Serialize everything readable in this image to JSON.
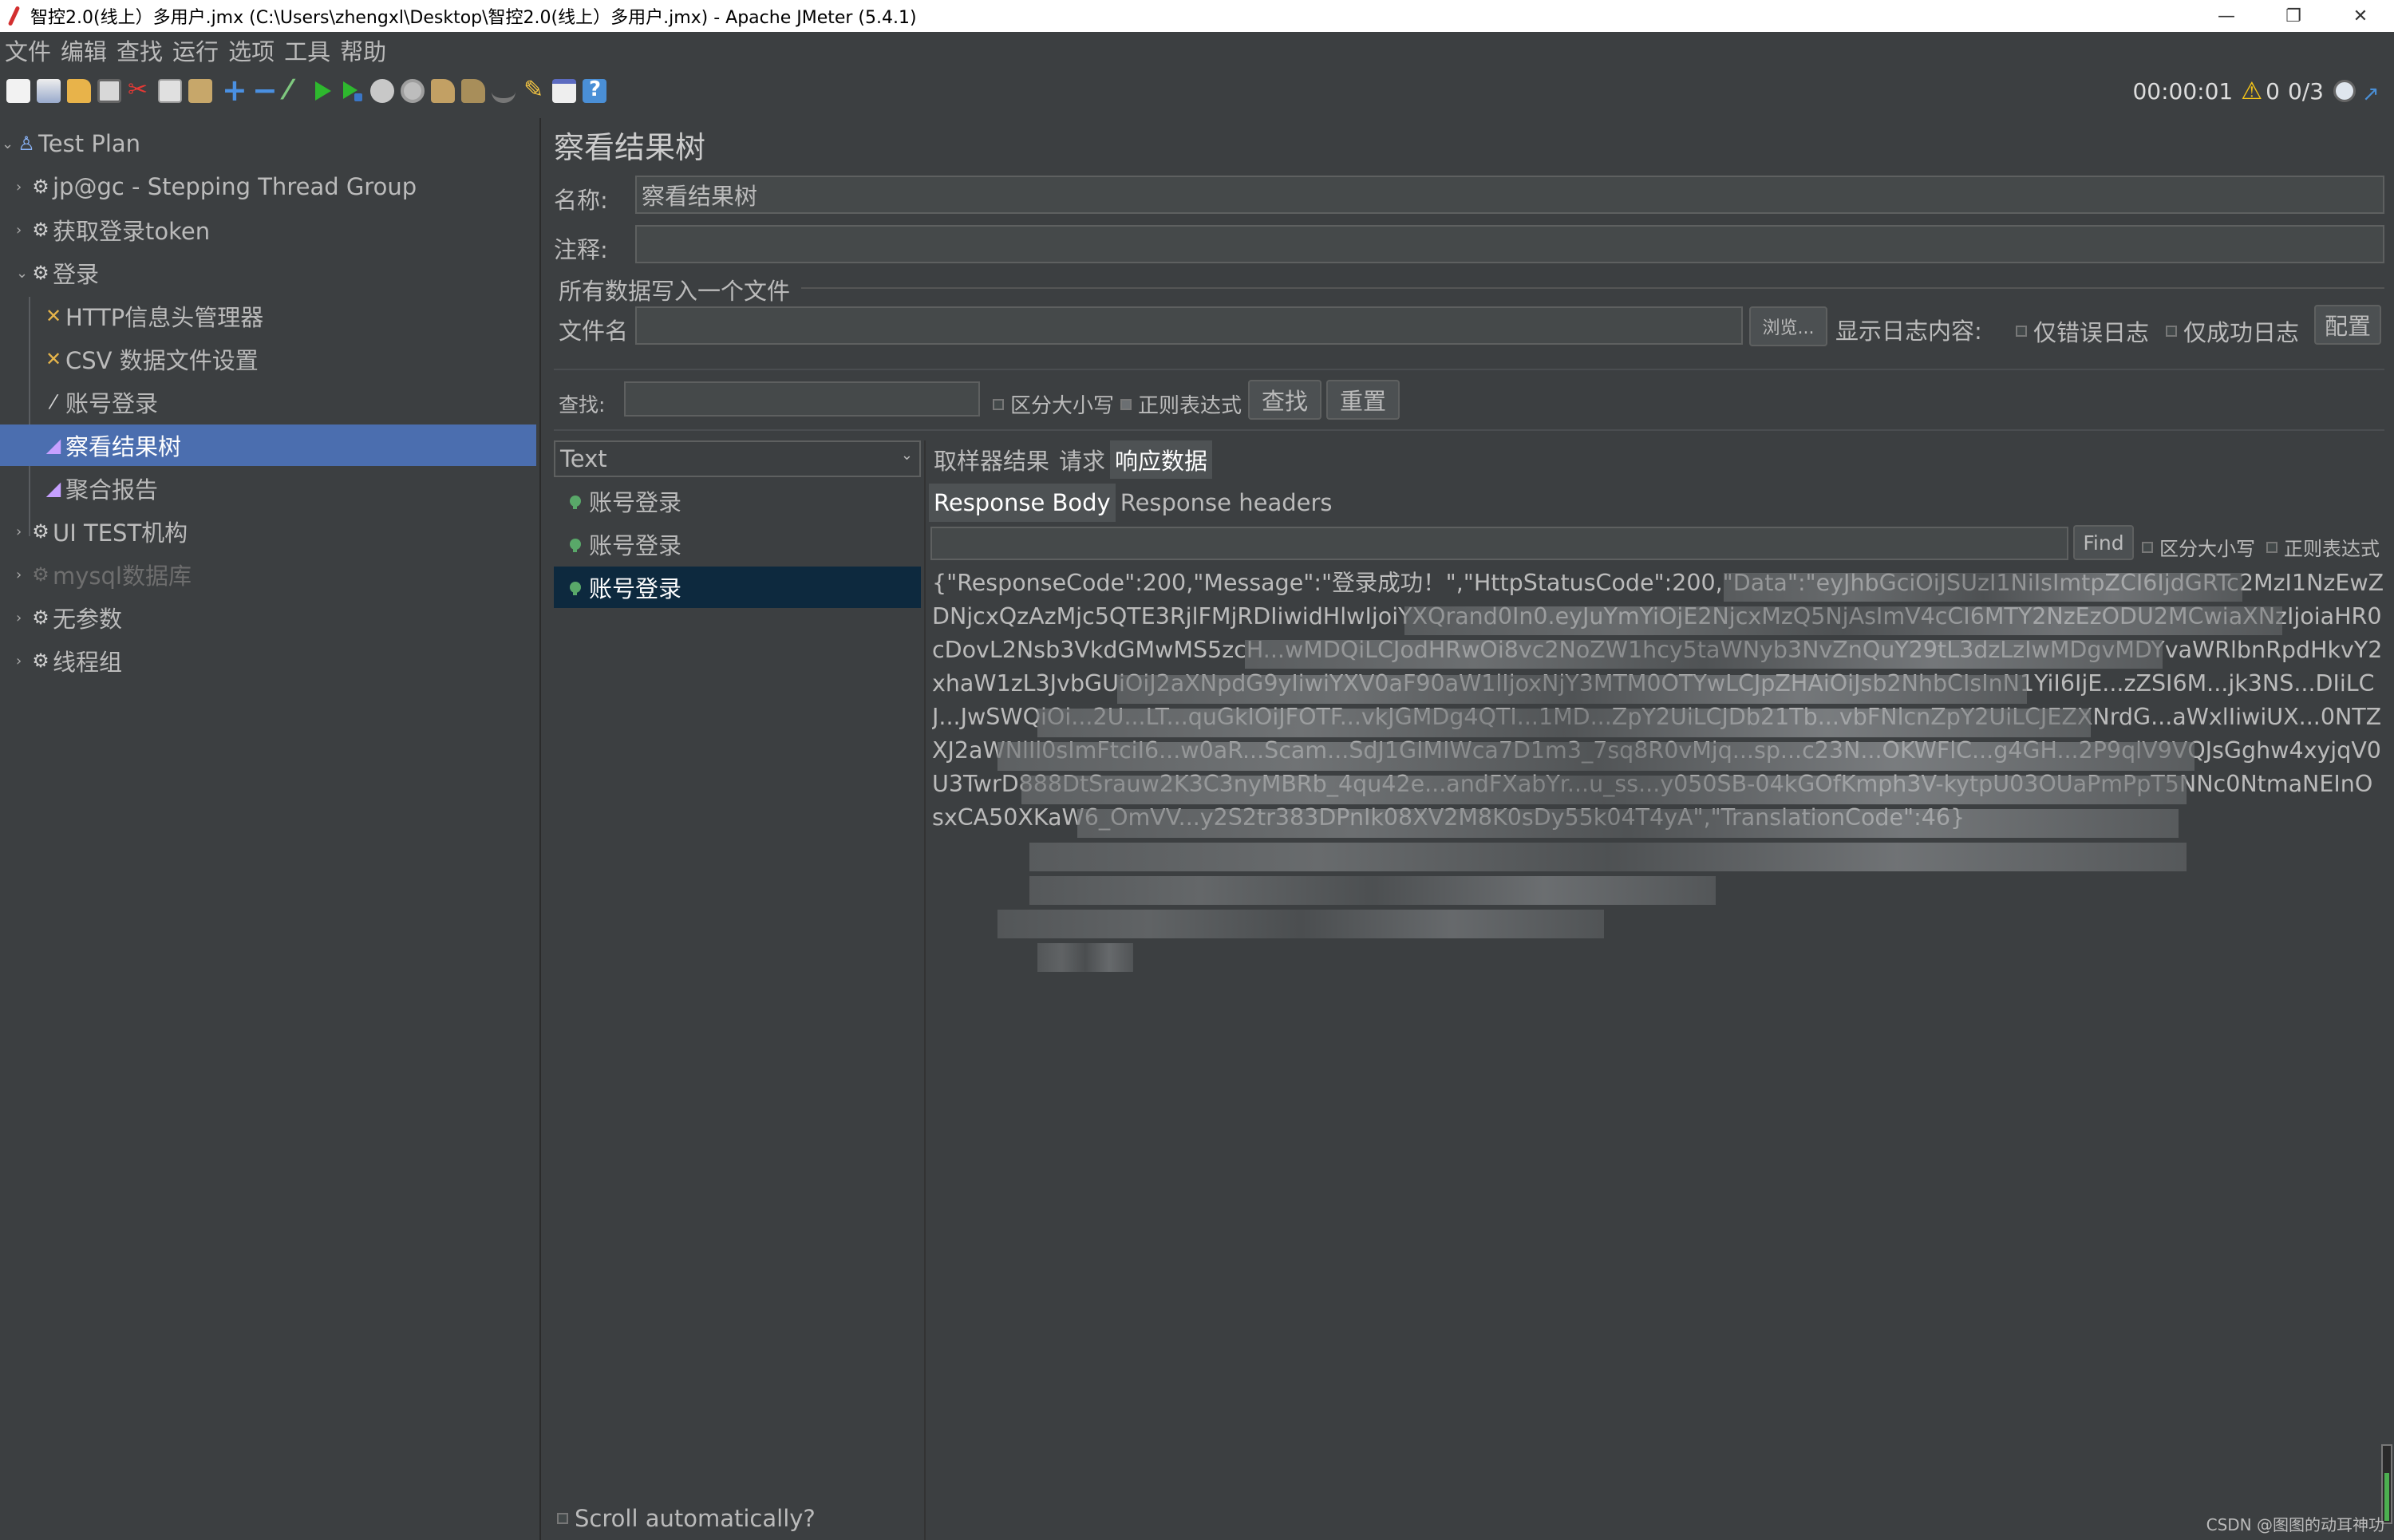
{
  "window": {
    "title": "智控2.0(线上）多用户.jmx (C:\\Users\\zhengxl\\Desktop\\智控2.0(线上）多用户.jmx) - Apache JMeter (5.4.1)",
    "minimize": "—",
    "maximize": "❐",
    "close": "✕"
  },
  "menu": [
    "文件",
    "编辑",
    "查找",
    "运行",
    "选项",
    "工具",
    "帮助"
  ],
  "status": {
    "elapsed": "00:00:01",
    "warnings": "0",
    "threads": "0/3"
  },
  "tree": [
    {
      "label": "Test Plan",
      "icon": "test-plan-icon"
    },
    {
      "label": "jp@gc - Stepping Thread Group",
      "icon": "gear-icon"
    },
    {
      "label": "获取登录token",
      "icon": "gear-icon"
    },
    {
      "label": "登录",
      "icon": "gear-icon"
    },
    {
      "label": "HTTP信息头管理器",
      "icon": "tool-icon"
    },
    {
      "label": "CSV 数据文件设置",
      "icon": "tool-icon"
    },
    {
      "label": "账号登录",
      "icon": "pen-icon"
    },
    {
      "label": "察看结果树",
      "icon": "graph-icon"
    },
    {
      "label": "聚合报告",
      "icon": "graph-icon"
    },
    {
      "label": "UI TEST机构",
      "icon": "gear-icon"
    },
    {
      "label": "mysql数据库",
      "icon": "gear-icon"
    },
    {
      "label": "无参数",
      "icon": "gear-icon"
    },
    {
      "label": "线程组",
      "icon": "gear-icon"
    }
  ],
  "panel": {
    "title": "察看结果树",
    "name_label": "名称:",
    "name_value": "察看结果树",
    "comment_label": "注释:",
    "comment_value": "",
    "file_section": "所有数据写入一个文件",
    "filename_label": "文件名",
    "filename_value": "",
    "browse": "浏览...",
    "log_display": "显示日志内容:",
    "errors_only": "仅错误日志",
    "success_only": "仅成功日志",
    "configure": "配置",
    "search_label": "查找:",
    "search_value": "",
    "case_sensitive": "区分大小写",
    "regex": "正则表达式",
    "find_btn": "查找",
    "reset_btn": "重置"
  },
  "results": {
    "renderer": "Text",
    "items": [
      "账号登录",
      "账号登录",
      "账号登录"
    ],
    "selected_index": 2,
    "scroll_auto": "Scroll automatically?"
  },
  "detail": {
    "tabs": [
      "取样器结果",
      "请求",
      "响应数据"
    ],
    "active_tab": 2,
    "subtabs": [
      "Response Body",
      "Response headers"
    ],
    "active_subtab": 0,
    "find_value": "",
    "find_btn": "Find",
    "case_sensitive": "区分大小写",
    "regex": "正则表达式",
    "response_body": "{\"ResponseCode\":200,\"Message\":\"登录成功！\",\"HttpStatusCode\":200,\"Data\":\"eyJhbGciOiJSUzI1NiIsImtpZCI6IjdGRTc2MzI1NzEwZDNjcxQzAzMjc5QTE3RjlFMjRDIiwidHlwIjoiYXQrand0In0.eyJuYmYiOjE2NjcxMzQ5NjAsImV4cCI6MTY2NzEzODU2MCwiaXNzIjoiaHR0cDovL2Nsb3VkdGMwMS5zcH...wMDQiLCJodHRwOi8vc2NoZW1hcy5taWNyb3NvZnQuY29tL3dzLzIwMDgvMDYvaWRlbnRpdHkvY2xhaW1zL3JvbGUiOiJ2aXNpdG9yIiwiYXV0aF90aW1lIjoxNjY3MTM0OTYwLCJpZHAiOiJsb2NhbCIsInN1YiI6IjE...zZSI6M...jk3NS...DIiLCJ...JwSWQiOi...2U...LT...quGkIOiJFOTF...vkJGMDg4QTI...1MD...ZpY2UiLCJDb21Tb...vbFNlcnZpY2UiLCJEZXNrdG...aWxlIiwiUX...0NTZXJ2aWNlIl0sImFtciI6...w0aR...Scam...SdJ1GIMIWca7D1m3_7sq8R0vMjq...sp...c23N...OKWFlC...g4GH...2P9qlV9VQJsGghw4xyjqV0U3TwrD888DtSrauw2K3C3nyMBRb_4qu42e...andFXabYr...u_ss...y050SB-04kGOfKmph3V-kytpU03OUaPmPpT5NNc0NtmaNEInOsxCA50XKaW6_OmVV...y2S2tr383DPnIk08XV2M8K0sDy55k04T4yA\",\"TranslationCode\":46}"
  },
  "watermark": "CSDN @图图的动耳神功"
}
